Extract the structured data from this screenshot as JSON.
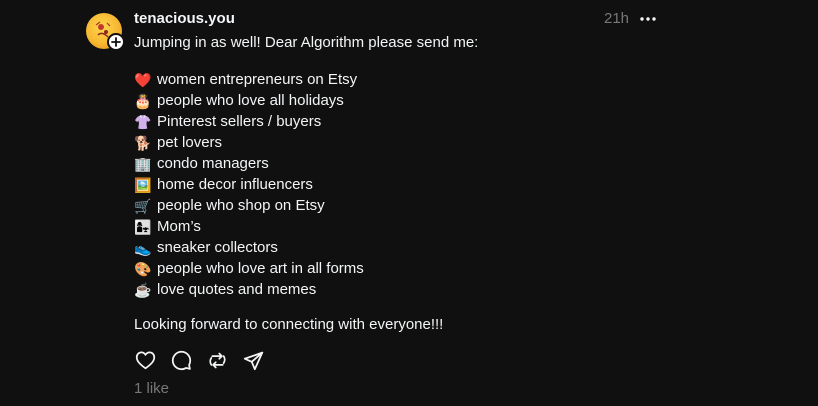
{
  "post": {
    "username": "tenacious.you",
    "time": "21h",
    "intro": "Jumping in as well! Dear Algorithm please send me:",
    "items": [
      {
        "emoji": "❤️",
        "icon": "red-heart-icon",
        "text": "women entrepreneurs on Etsy"
      },
      {
        "emoji": "🎂",
        "icon": "birthday-cake-icon",
        "text": "people who love all holidays"
      },
      {
        "emoji": "👚",
        "icon": "blouse-icon",
        "text": "Pinterest sellers / buyers"
      },
      {
        "emoji": "🐕",
        "icon": "dog-icon",
        "text": "pet lovers"
      },
      {
        "emoji": "🏢",
        "icon": "office-building-icon",
        "text": "condo managers"
      },
      {
        "emoji": "🖼️",
        "icon": "framed-picture-icon",
        "text": "home decor influencers"
      },
      {
        "emoji": "🛒",
        "icon": "shopping-cart-icon",
        "text": "people who shop on Etsy"
      },
      {
        "emoji": "👩‍👧",
        "icon": "mother-daughter-icon",
        "text": "Mom’s"
      },
      {
        "emoji": "👟",
        "icon": "sneaker-icon",
        "text": "sneaker collectors"
      },
      {
        "emoji": "🎨",
        "icon": "artist-palette-icon",
        "text": "people who love art in all forms"
      },
      {
        "emoji": "☕",
        "icon": "coffee-icon",
        "text": "love quotes and memes"
      }
    ],
    "closing": "Looking forward to connecting with everyone!!!",
    "likes": "1 like"
  },
  "colors": {
    "background": "#101010",
    "text": "#f3f5f7",
    "muted": "#777777"
  }
}
